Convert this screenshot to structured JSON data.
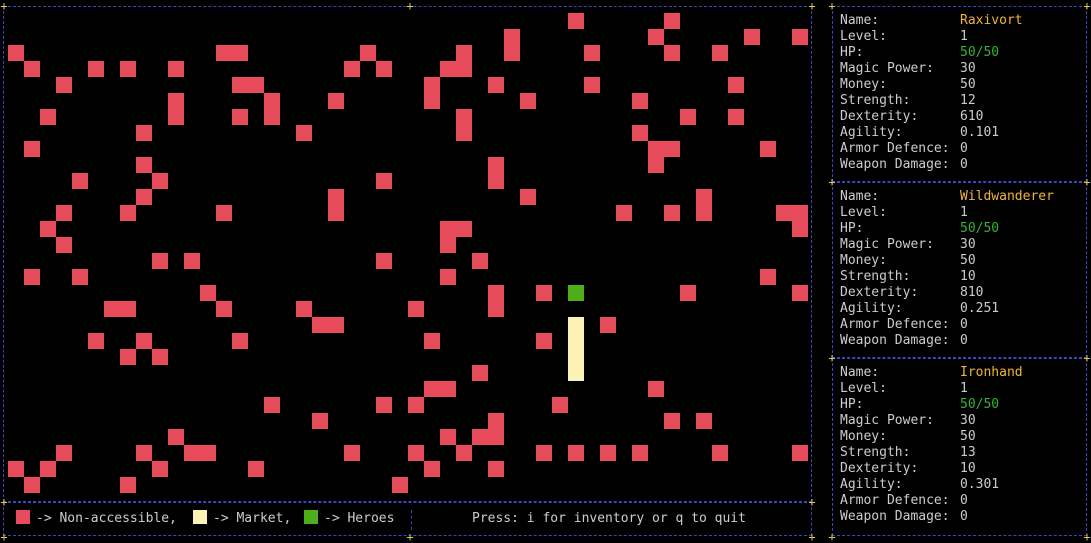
{
  "map": {
    "colors": {
      "non_accessible": "#e84b5b",
      "market": "#fbf3b4",
      "hero": "#4caf1a"
    },
    "non_accessible": [
      [
        35,
        0
      ],
      [
        41,
        0
      ],
      [
        31,
        1
      ],
      [
        40,
        1
      ],
      [
        46,
        1
      ],
      [
        49,
        1
      ],
      [
        0,
        2
      ],
      [
        13,
        2
      ],
      [
        14,
        2
      ],
      [
        22,
        2
      ],
      [
        28,
        2
      ],
      [
        31,
        2
      ],
      [
        36,
        2
      ],
      [
        41,
        2
      ],
      [
        44,
        2
      ],
      [
        1,
        3
      ],
      [
        5,
        3
      ],
      [
        7,
        3
      ],
      [
        10,
        3
      ],
      [
        21,
        3
      ],
      [
        23,
        3
      ],
      [
        27,
        3
      ],
      [
        28,
        3
      ],
      [
        3,
        4
      ],
      [
        14,
        4
      ],
      [
        15,
        4
      ],
      [
        26,
        4
      ],
      [
        30,
        4
      ],
      [
        36,
        4
      ],
      [
        45,
        4
      ],
      [
        10,
        5
      ],
      [
        16,
        5
      ],
      [
        20,
        5
      ],
      [
        26,
        5
      ],
      [
        32,
        5
      ],
      [
        39,
        5
      ],
      [
        2,
        6
      ],
      [
        10,
        6
      ],
      [
        14,
        6
      ],
      [
        16,
        6
      ],
      [
        28,
        6
      ],
      [
        42,
        6
      ],
      [
        45,
        6
      ],
      [
        8,
        7
      ],
      [
        18,
        7
      ],
      [
        28,
        7
      ],
      [
        39,
        7
      ],
      [
        1,
        8
      ],
      [
        40,
        8
      ],
      [
        41,
        8
      ],
      [
        47,
        8
      ],
      [
        8,
        9
      ],
      [
        30,
        9
      ],
      [
        40,
        9
      ],
      [
        4,
        10
      ],
      [
        9,
        10
      ],
      [
        23,
        10
      ],
      [
        30,
        10
      ],
      [
        8,
        11
      ],
      [
        20,
        11
      ],
      [
        32,
        11
      ],
      [
        43,
        11
      ],
      [
        3,
        12
      ],
      [
        7,
        12
      ],
      [
        13,
        12
      ],
      [
        20,
        12
      ],
      [
        38,
        12
      ],
      [
        41,
        12
      ],
      [
        43,
        12
      ],
      [
        48,
        12
      ],
      [
        49,
        12
      ],
      [
        2,
        13
      ],
      [
        27,
        13
      ],
      [
        28,
        13
      ],
      [
        49,
        13
      ],
      [
        3,
        14
      ],
      [
        27,
        14
      ],
      [
        9,
        15
      ],
      [
        11,
        15
      ],
      [
        23,
        15
      ],
      [
        29,
        15
      ],
      [
        1,
        16
      ],
      [
        4,
        16
      ],
      [
        27,
        16
      ],
      [
        47,
        16
      ],
      [
        12,
        17
      ],
      [
        30,
        17
      ],
      [
        33,
        17
      ],
      [
        42,
        17
      ],
      [
        49,
        17
      ],
      [
        6,
        18
      ],
      [
        7,
        18
      ],
      [
        13,
        18
      ],
      [
        18,
        18
      ],
      [
        25,
        18
      ],
      [
        30,
        18
      ],
      [
        19,
        19
      ],
      [
        20,
        19
      ],
      [
        37,
        19
      ],
      [
        5,
        20
      ],
      [
        8,
        20
      ],
      [
        14,
        20
      ],
      [
        26,
        20
      ],
      [
        33,
        20
      ],
      [
        7,
        21
      ],
      [
        9,
        21
      ],
      [
        29,
        22
      ],
      [
        26,
        23
      ],
      [
        27,
        23
      ],
      [
        40,
        23
      ],
      [
        16,
        24
      ],
      [
        23,
        24
      ],
      [
        25,
        24
      ],
      [
        34,
        24
      ],
      [
        19,
        25
      ],
      [
        30,
        25
      ],
      [
        41,
        25
      ],
      [
        43,
        25
      ],
      [
        10,
        26
      ],
      [
        27,
        26
      ],
      [
        29,
        26
      ],
      [
        30,
        26
      ],
      [
        3,
        27
      ],
      [
        8,
        27
      ],
      [
        11,
        27
      ],
      [
        12,
        27
      ],
      [
        21,
        27
      ],
      [
        25,
        27
      ],
      [
        28,
        27
      ],
      [
        33,
        27
      ],
      [
        35,
        27
      ],
      [
        37,
        27
      ],
      [
        39,
        27
      ],
      [
        44,
        27
      ],
      [
        49,
        27
      ],
      [
        0,
        28
      ],
      [
        2,
        28
      ],
      [
        9,
        28
      ],
      [
        15,
        28
      ],
      [
        26,
        28
      ],
      [
        30,
        28
      ],
      [
        1,
        29
      ],
      [
        7,
        29
      ],
      [
        24,
        29
      ]
    ],
    "market": [
      [
        35,
        19
      ],
      [
        35,
        20
      ],
      [
        35,
        21
      ],
      [
        35,
        22
      ]
    ],
    "heroes": [
      [
        35,
        17
      ]
    ]
  },
  "legend": {
    "non_accessible_label": "-> Non-accessible,",
    "market_label": "-> Market,",
    "heroes_label": "-> Heroes"
  },
  "hint": "Press: i for inventory or q to quit",
  "labels": {
    "name": "Name:",
    "level": "Level:",
    "hp": "HP:",
    "magic_power": "Magic Power:",
    "money": "Money:",
    "strength": "Strength:",
    "dexterity": "Dexterity:",
    "agility": "Agility:",
    "armor_defence": "Armor Defence:",
    "weapon_damage": "Weapon Damage:"
  },
  "heroes": [
    {
      "name": "Raxivort",
      "level": "1",
      "hp": "50/50",
      "magic_power": "30",
      "money": "50",
      "strength": "12",
      "dexterity": "610",
      "agility": "0.101",
      "armor_defence": "0",
      "weapon_damage": "0"
    },
    {
      "name": "Wildwanderer",
      "level": "1",
      "hp": "50/50",
      "magic_power": "30",
      "money": "50",
      "strength": "10",
      "dexterity": "810",
      "agility": "0.251",
      "armor_defence": "0",
      "weapon_damage": "0"
    },
    {
      "name": "Ironhand",
      "level": "1",
      "hp": "50/50",
      "magic_power": "30",
      "money": "50",
      "strength": "13",
      "dexterity": "10",
      "agility": "0.301",
      "armor_defence": "0",
      "weapon_damage": "0"
    }
  ]
}
